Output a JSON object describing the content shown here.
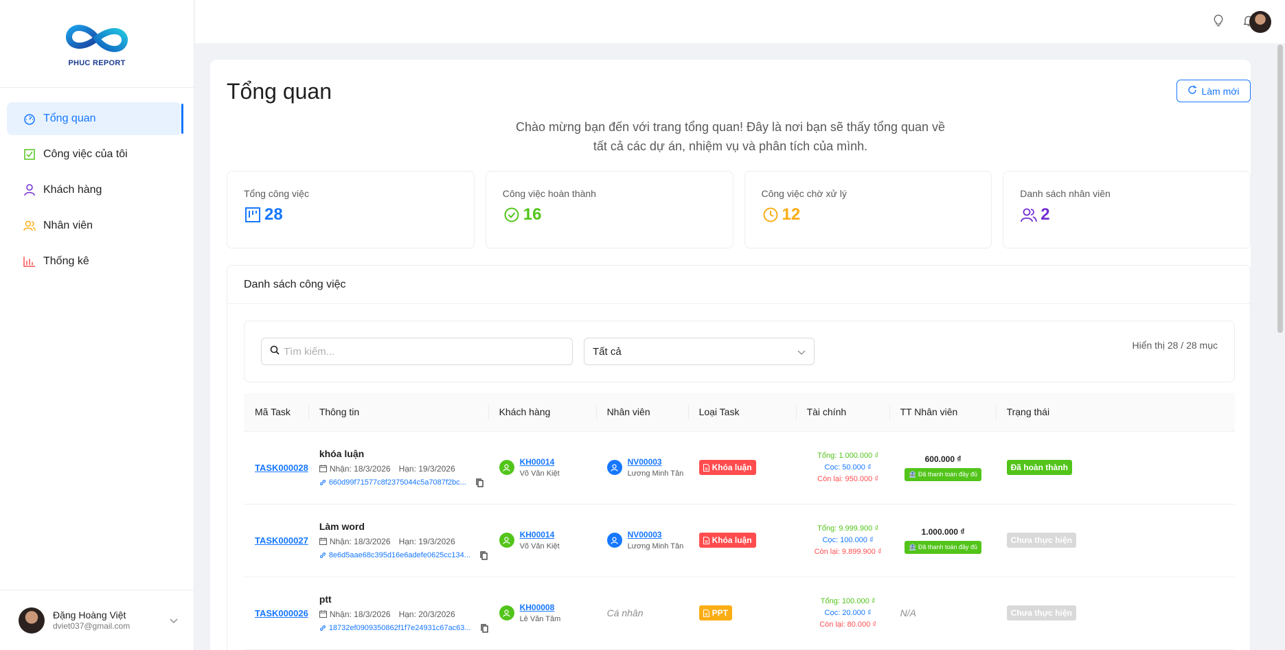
{
  "brand": {
    "name": "PHUC REPORT"
  },
  "sidebar": {
    "items": [
      {
        "label": "Tổng quan",
        "icon": "dashboard-icon",
        "active": true
      },
      {
        "label": "Công việc của tôi",
        "icon": "checkbox-icon",
        "active": false
      },
      {
        "label": "Khách hàng",
        "icon": "user-icon",
        "active": false
      },
      {
        "label": "Nhân viên",
        "icon": "users-icon",
        "active": false
      },
      {
        "label": "Thống kê",
        "icon": "bar-chart-icon",
        "active": false
      }
    ],
    "user": {
      "name": "Đặng Hoàng Việt",
      "email": "dviet037@gmail.com"
    }
  },
  "header": {
    "icons": [
      "bulb-icon",
      "bell-icon",
      "avatar"
    ]
  },
  "page": {
    "title": "Tổng quan",
    "refresh_label": "Làm mới",
    "welcome": "Chào mừng bạn đến với trang tổng quan! Đây là nơi bạn sẽ thấy tổng quan về tất cả các dự án, nhiệm vụ và phân tích của mình."
  },
  "stats": [
    {
      "label": "Tổng công việc",
      "value": "28",
      "color": "#1677ff",
      "icon": "board-icon"
    },
    {
      "label": "Công việc hoàn thành",
      "value": "16",
      "color": "#52c41a",
      "icon": "check-circle-icon"
    },
    {
      "label": "Công việc chờ xử lý",
      "value": "12",
      "color": "#faad14",
      "icon": "clock-icon"
    },
    {
      "label": "Danh sách nhân viên",
      "value": "2",
      "color": "#722ed1",
      "icon": "team-icon"
    }
  ],
  "task_list": {
    "title": "Danh sách công việc",
    "search_placeholder": "Tìm kiếm...",
    "filter_value": "Tất cả",
    "count_text": "Hiển thị 28 / 28 mục",
    "columns": [
      "Mã Task",
      "Thông tin",
      "Khách hàng",
      "Nhân viên",
      "Loại Task",
      "Tài chính",
      "TT Nhân viên",
      "Trạng thái"
    ],
    "rows": [
      {
        "id": "TASK000028",
        "title": "khóa luận",
        "received": "Nhận: 18/3/2026",
        "deadline": "Hạn: 19/3/2026",
        "link": "660d99f71577c8f2375044c5a7087f2bc...",
        "customer_code": "KH00014",
        "customer_name": "Võ Văn Kiệt",
        "employee_code": "NV00003",
        "employee_name": "Lương Minh Tân",
        "employee_text": "",
        "type": "Khóa luận",
        "type_color": "#ff4d4f",
        "total": "Tổng: 1.000.000 ₫",
        "deposit": "Cọc: 50.000 ₫",
        "remaining": "Còn lại: 950.000 ₫",
        "emp_amount": "600.000 ₫",
        "emp_paid": "Đã thanh toán đầy đủ",
        "emp_text": "",
        "status": "Đã hoàn thành",
        "status_kind": "done"
      },
      {
        "id": "TASK000027",
        "title": "Làm word",
        "received": "Nhận: 18/3/2026",
        "deadline": "Hạn: 19/3/2026",
        "link": "8e6d5aae68c395d16e6adefe0625cc134...",
        "customer_code": "KH00014",
        "customer_name": "Võ Văn Kiệt",
        "employee_code": "NV00003",
        "employee_name": "Lương Minh Tân",
        "employee_text": "",
        "type": "Khóa luận",
        "type_color": "#ff4d4f",
        "total": "Tổng: 9.999.900 ₫",
        "deposit": "Cọc: 100.000 ₫",
        "remaining": "Còn lại: 9.899.900 ₫",
        "emp_amount": "1.000.000 ₫",
        "emp_paid": "Đã thanh toán đầy đủ",
        "emp_text": "",
        "status": "Chưa thực hiện",
        "status_kind": "todo"
      },
      {
        "id": "TASK000026",
        "title": "ptt",
        "received": "Nhận: 18/3/2026",
        "deadline": "Hạn: 20/3/2026",
        "link": "18732ef0909350862f1f7e24931c67ac63...",
        "customer_code": "KH00008",
        "customer_name": "Lê Văn Tâm",
        "employee_code": "",
        "employee_name": "",
        "employee_text": "Cá nhân",
        "type": "PPT",
        "type_color": "#faad14",
        "total": "Tổng: 100.000 ₫",
        "deposit": "Cọc: 20.000 ₫",
        "remaining": "Còn lại: 80.000 ₫",
        "emp_amount": "",
        "emp_paid": "",
        "emp_text": "N/A",
        "status": "Chưa thực hiện",
        "status_kind": "todo"
      }
    ]
  }
}
